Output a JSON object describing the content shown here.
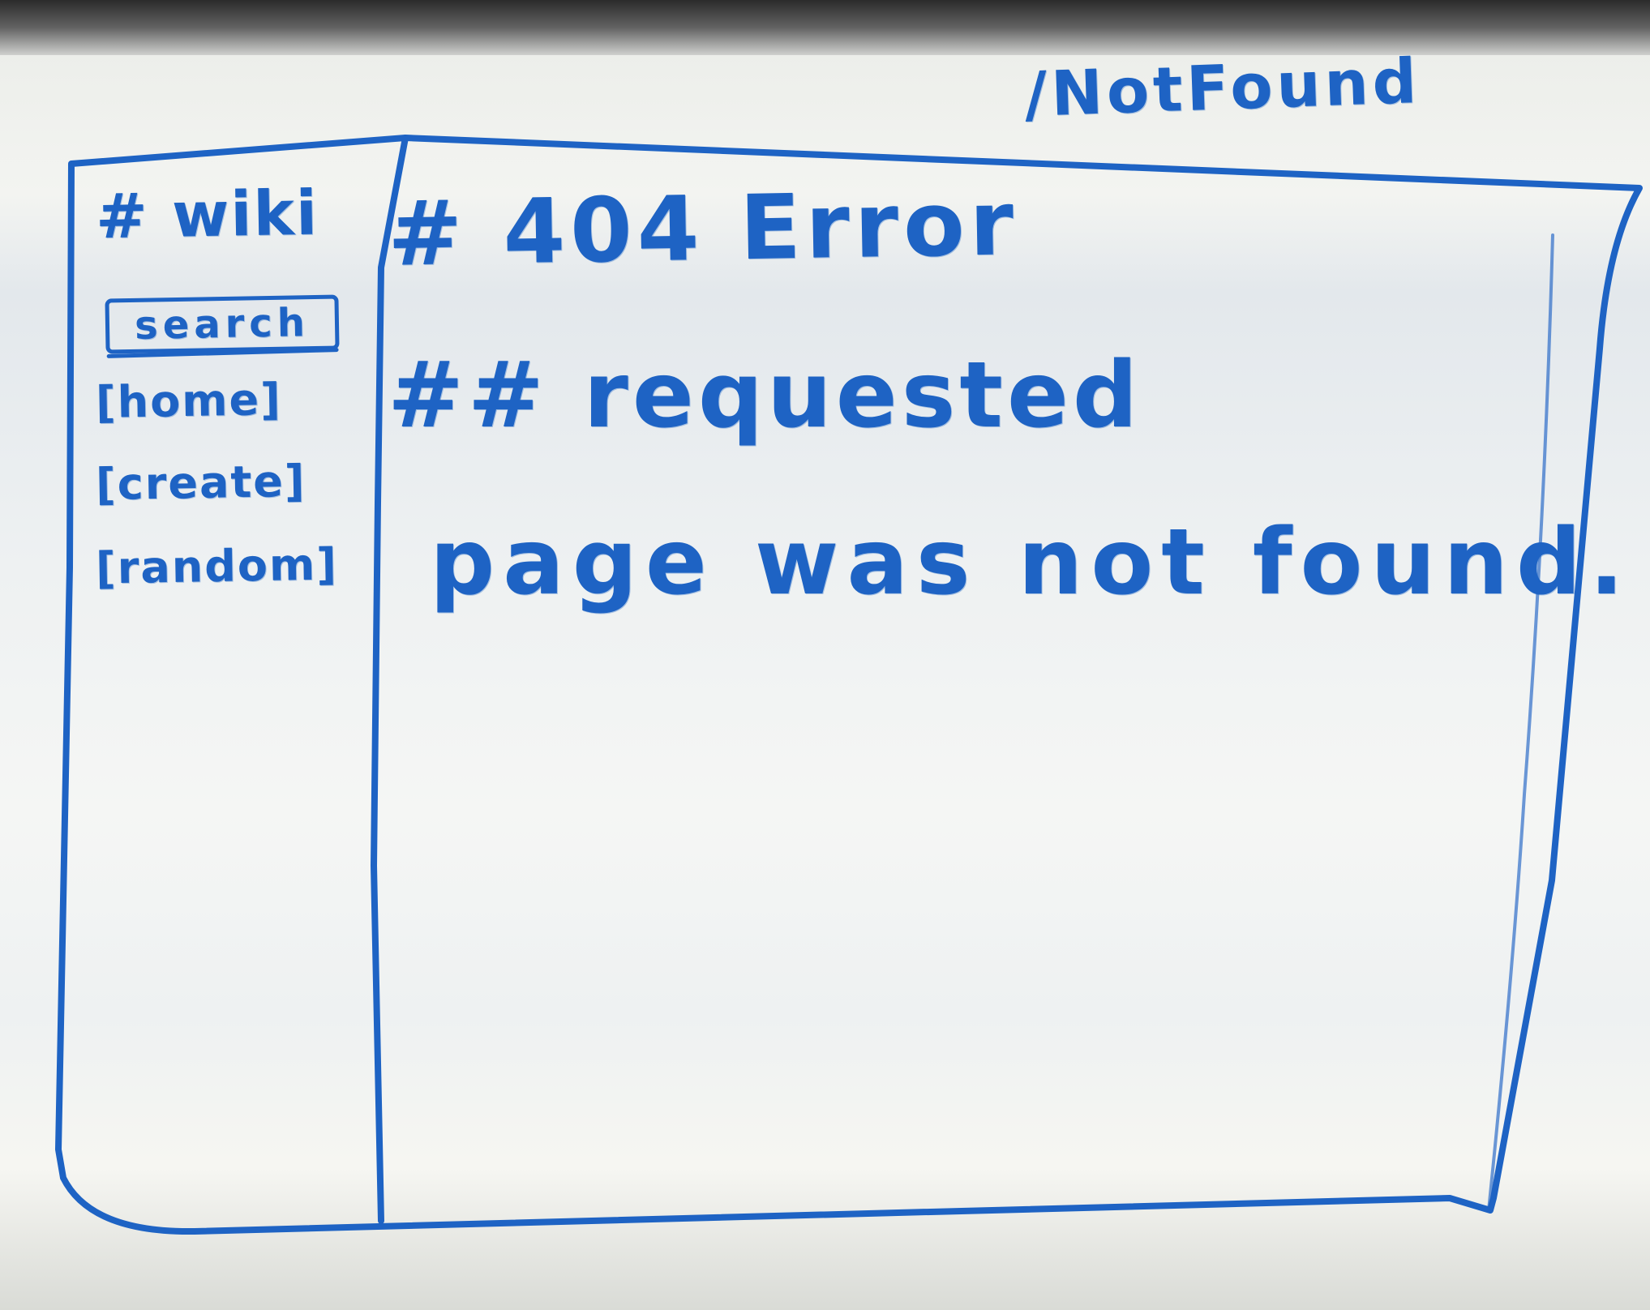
{
  "app": {
    "route": "/NotFound"
  },
  "sidebar": {
    "title": "# wiki",
    "search_label": "search",
    "items": [
      {
        "label": "[home]"
      },
      {
        "label": "[create]"
      },
      {
        "label": "[random]"
      }
    ]
  },
  "main": {
    "heading": "# 404 Error",
    "subheading_line1": "## requested",
    "subheading_line2": "page was not found."
  },
  "colors": {
    "marker": "#1e63c4",
    "board": "#f3f4f1"
  }
}
